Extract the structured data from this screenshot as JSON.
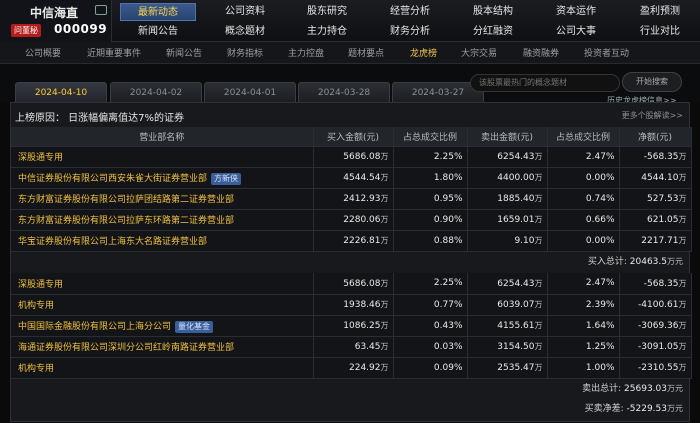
{
  "brand": {
    "name": "中信海直",
    "tag": "问董秘",
    "code": "000099"
  },
  "nav": [
    [
      "最新动态",
      "公司资料",
      "股东研究",
      "经营分析",
      "股本结构",
      "资本运作",
      "盈利预测"
    ],
    [
      "新闻公告",
      "概念题材",
      "主力持仓",
      "财务分析",
      "分红融资",
      "公司大事",
      "行业对比"
    ]
  ],
  "subnav": [
    "公司概要",
    "近期重要事件",
    "新闻公告",
    "财务指标",
    "主力控盘",
    "题材要点",
    "龙虎榜",
    "大宗交易",
    "融资融券",
    "投资者互动"
  ],
  "tabs": [
    "2024-04-10",
    "2024-04-02",
    "2024-04-01",
    "2024-03-28",
    "2024-03-27"
  ],
  "search": {
    "placeholder": "该股票最热门的概念题材",
    "button": "开始搜索"
  },
  "history_link": "历史龙虎榜信息>>",
  "reason": "上榜原因：  日涨幅偏离值达7%的证券",
  "more": "更多个股解读>>",
  "headers": [
    "营业部名称",
    "买入金额(元)",
    "占总成交比例",
    "卖出金额(元)",
    "占总成交比例",
    "净额(元)"
  ],
  "unit": "万",
  "buy_rows": [
    {
      "name": "深股通专用",
      "badge": "",
      "buy": "5686.08",
      "buy_pct": "2.25%",
      "sell": "6254.43",
      "sell_pct": "2.47%",
      "net": "-568.35"
    },
    {
      "name": "中信证券股份有限公司西安朱雀大街证券营业部",
      "badge": "方新侠",
      "buy": "4544.54",
      "buy_pct": "1.80%",
      "sell": "4400.00",
      "sell_pct": "0.00%",
      "net": "4544.10"
    },
    {
      "name": "东方财富证券股份有限公司拉萨团结路第二证券营业部",
      "badge": "",
      "buy": "2412.93",
      "buy_pct": "0.95%",
      "sell": "1885.40",
      "sell_pct": "0.74%",
      "net": "527.53"
    },
    {
      "name": "东方财富证券股份有限公司拉萨东环路第二证券营业部",
      "badge": "",
      "buy": "2280.06",
      "buy_pct": "0.90%",
      "sell": "1659.01",
      "sell_pct": "0.66%",
      "net": "621.05"
    },
    {
      "name": "华宝证券股份有限公司上海东大名路证券营业部",
      "badge": "",
      "buy": "2226.81",
      "buy_pct": "0.88%",
      "sell": "9.10",
      "sell_pct": "0.00%",
      "net": "2217.71"
    }
  ],
  "buy_total": {
    "label": "买入总计:",
    "value": "20463.5",
    "unit": "万元"
  },
  "sell_rows": [
    {
      "name": "深股通专用",
      "badge": "",
      "buy": "5686.08",
      "buy_pct": "2.25%",
      "sell": "6254.43",
      "sell_pct": "2.47%",
      "net": "-568.35"
    },
    {
      "name": "机构专用",
      "badge": "",
      "buy": "1938.46",
      "buy_pct": "0.77%",
      "sell": "6039.07",
      "sell_pct": "2.39%",
      "net": "-4100.61"
    },
    {
      "name": "中国国际金融股份有限公司上海分公司",
      "badge": "量化基金",
      "buy": "1086.25",
      "buy_pct": "0.43%",
      "sell": "4155.61",
      "sell_pct": "1.64%",
      "net": "-3069.36"
    },
    {
      "name": "海通证券股份有限公司深圳分公司红岭南路证券营业部",
      "badge": "",
      "buy": "63.45",
      "buy_pct": "0.03%",
      "sell": "3154.50",
      "sell_pct": "1.25%",
      "net": "-3091.05"
    },
    {
      "name": "机构专用",
      "badge": "",
      "buy": "224.92",
      "buy_pct": "0.09%",
      "sell": "2535.47",
      "sell_pct": "1.00%",
      "net": "-2310.55"
    }
  ],
  "sell_total": {
    "label": "卖出总计:",
    "value": "25693.03",
    "unit": "万元"
  },
  "net_total": {
    "label": "买卖净差:",
    "value": "-5229.53",
    "unit": "万元"
  }
}
